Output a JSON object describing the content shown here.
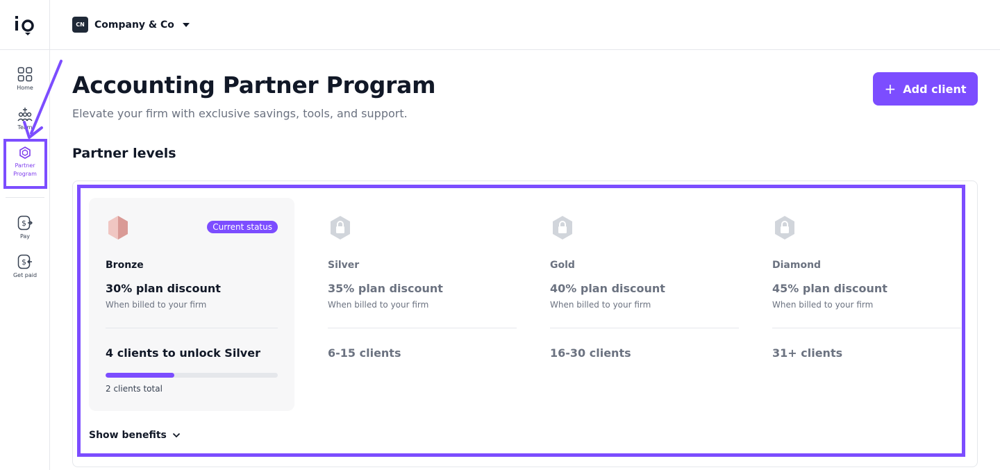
{
  "app": {
    "logo_text": "io"
  },
  "sidebar": {
    "items": [
      {
        "label": "Home",
        "icon": "grid-icon",
        "active": false
      },
      {
        "label": "Team",
        "icon": "team-icon",
        "active": false
      },
      {
        "label": "Partner Program",
        "icon": "gem-icon",
        "active": true
      },
      {
        "label": "Pay",
        "icon": "pay-icon",
        "active": false
      },
      {
        "label": "Get paid",
        "icon": "get-paid-icon",
        "active": false
      }
    ]
  },
  "topbar": {
    "company_badge": "CN",
    "company_name": "Company & Co"
  },
  "header": {
    "title": "Accounting Partner Program",
    "subtitle": "Elevate your firm with exclusive savings, tools, and support.",
    "add_client_label": "Add client"
  },
  "partner_levels": {
    "title": "Partner levels",
    "levels": [
      {
        "name": "Bronze",
        "discount": "30% plan discount",
        "billed": "When billed to your firm",
        "clients": "4 clients to unlock Silver",
        "status_badge": "Current status",
        "progress": 0.4,
        "progress_text": "2 clients total",
        "current": true
      },
      {
        "name": "Silver",
        "discount": "35% plan discount",
        "billed": "When billed to your firm",
        "clients": "6-15 clients",
        "locked": true
      },
      {
        "name": "Gold",
        "discount": "40% plan discount",
        "billed": "When billed to your firm",
        "clients": "16-30 clients",
        "locked": true
      },
      {
        "name": "Diamond",
        "discount": "45% plan discount",
        "billed": "When billed to your firm",
        "clients": "31+ clients",
        "locked": true
      }
    ],
    "show_benefits_label": "Show benefits"
  },
  "colors": {
    "accent": "#7c4dff",
    "bronze": "#e8b4b0",
    "locked": "#d1d5db"
  }
}
